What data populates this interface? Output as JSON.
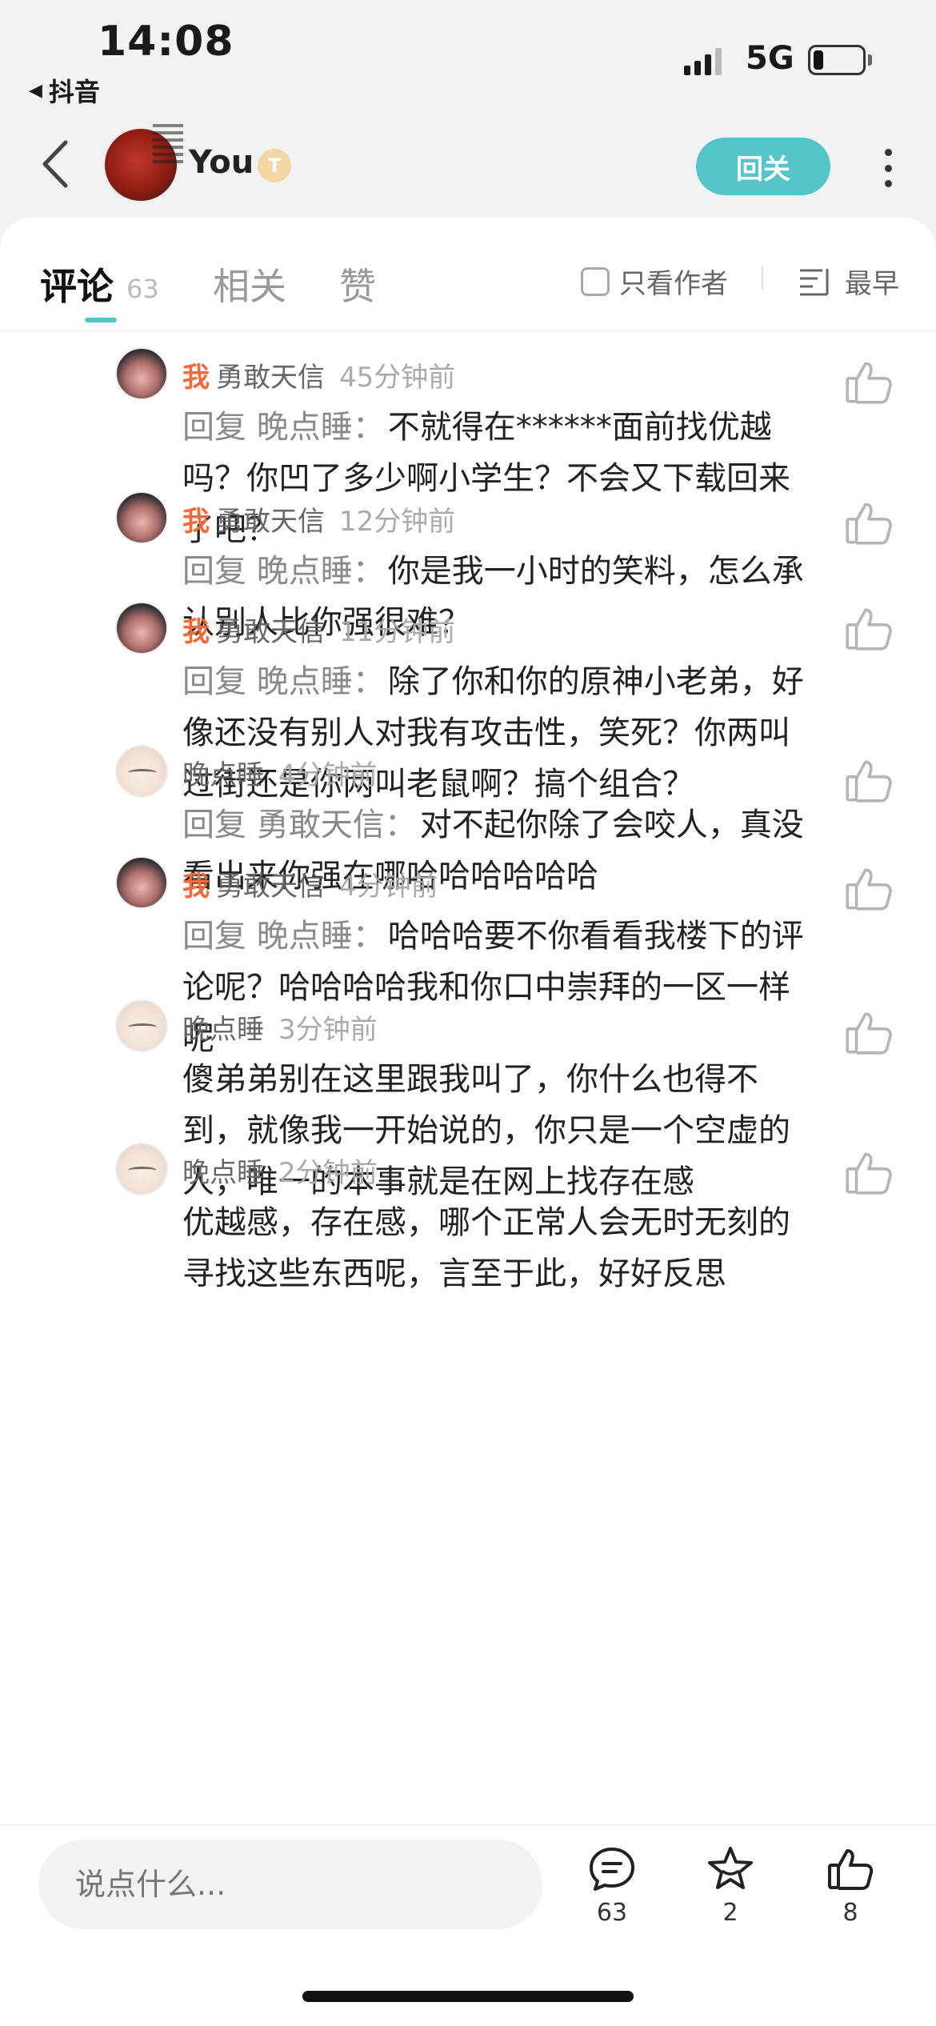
{
  "status_bar": {
    "time": "14:08",
    "back_app": "抖音",
    "network": "5G",
    "battery_level": 0.2
  },
  "header": {
    "username": "You",
    "badge": "T",
    "follow_label": "回关"
  },
  "tabs": {
    "comments_label": "评论",
    "comments_count": "63",
    "related_label": "相关",
    "likes_label": "赞",
    "author_only_label": "只看作者",
    "sort_label": "最早"
  },
  "comments": [
    {
      "is_me": true,
      "me_tag": "我",
      "name": "勇敢天信",
      "time": "45分钟前",
      "reply_prefix": "回复",
      "reply_to": "晚点睡：",
      "text": "不就得在******面前找优越吗？你凹了多少啊小学生？不会又下载回来了吧？"
    },
    {
      "is_me": true,
      "me_tag": "我",
      "name": "勇敢天信",
      "time": "12分钟前",
      "reply_prefix": "回复",
      "reply_to": "晚点睡：",
      "text": "你是我一小时的笑料，怎么承认别人比你强很难？"
    },
    {
      "is_me": true,
      "me_tag": "我",
      "name": "勇敢天信",
      "time": "11分钟前",
      "reply_prefix": "回复",
      "reply_to": "晚点睡：",
      "text": "除了你和你的原神小老弟，好像还没有别人对我有攻击性，笑死？你两叫过街还是你两叫老鼠啊？搞个组合？"
    },
    {
      "is_me": false,
      "me_tag": "",
      "name": "晚点睡",
      "time": "4分钟前",
      "reply_prefix": "回复",
      "reply_to": "勇敢天信：",
      "text": "对不起你除了会咬人，真没看出来你强在哪哈哈哈哈哈哈"
    },
    {
      "is_me": true,
      "me_tag": "我",
      "name": "勇敢天信",
      "time": "4分钟前",
      "reply_prefix": "回复",
      "reply_to": "晚点睡：",
      "text": "哈哈哈要不你看看我楼下的评论呢？哈哈哈哈我和你口中崇拜的一区一样呢"
    },
    {
      "is_me": false,
      "me_tag": "",
      "name": "晚点睡",
      "time": "3分钟前",
      "reply_prefix": "",
      "reply_to": "",
      "text": "傻弟弟别在这里跟我叫了，你什么也得不到，就像我一开始说的，你只是一个空虚的人，唯一的本事就是在网上找存在感"
    },
    {
      "is_me": false,
      "me_tag": "",
      "name": "晚点睡",
      "time": "2分钟前",
      "reply_prefix": "",
      "reply_to": "",
      "text": "优越感，存在感，哪个正常人会无时无刻的寻找这些东西呢，言至于此，好好反思"
    }
  ],
  "bottom_bar": {
    "input_placeholder": "说点什么...",
    "comment_count": "63",
    "favorite_count": "2",
    "like_count": "8"
  }
}
